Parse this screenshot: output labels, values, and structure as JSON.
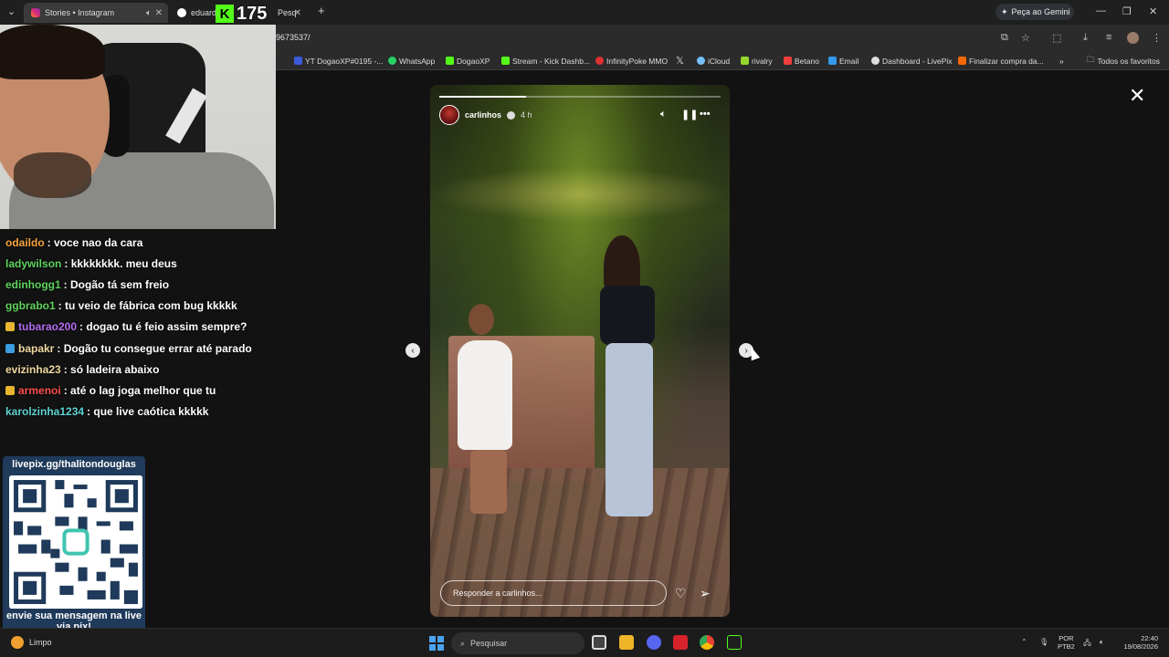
{
  "tabs": [
    {
      "title": "Stories • Instagram",
      "active": true
    },
    {
      "title": "eduarda",
      "active": false
    },
    {
      "title": "Pesq",
      "active": false
    }
  ],
  "new_tab_icon": "plus-icon",
  "gemini_label": "Peça ao Gemini",
  "url": "9673537/",
  "bookmarks": [
    {
      "label": "YT DogaoXP#0195 -...",
      "color": "#3b5bdb"
    },
    {
      "label": "WhatsApp",
      "color": "#25d366"
    },
    {
      "label": "DogaoXP",
      "color": "#53fc18"
    },
    {
      "label": "Stream - Kick Dashb...",
      "color": "#53fc18"
    },
    {
      "label": "InfinityPoke MMO",
      "color": "#e03131"
    },
    {
      "label": "",
      "color": "#ffffff"
    },
    {
      "label": "iCloud",
      "color": "#74c0fc"
    },
    {
      "label": "rivalry",
      "color": "#94d82d"
    },
    {
      "label": "Betano",
      "color": "#f03e3e"
    },
    {
      "label": "Email",
      "color": "#339af0"
    },
    {
      "label": "Dashboard - LivePix",
      "color": "#dddddd"
    },
    {
      "label": "Finalizar compra da...",
      "color": "#f76707"
    }
  ],
  "all_bookmarks": "Todos os favoritos",
  "kick_counter": "175",
  "story": {
    "username": "carlinhos",
    "time": "4 h",
    "progress": 0.31,
    "reply_placeholder": "Responder a carlinhos..."
  },
  "chat": [
    {
      "user": "odaildo",
      "color": "#f7a33a",
      "text": ": voce nao da cara",
      "badge": ""
    },
    {
      "user": "ladywilson",
      "color": "#5fd35f",
      "text": ": kkkkkkkk. meu deus",
      "badge": ""
    },
    {
      "user": "edinhogg1",
      "color": "#5fd35f",
      "text": ": Dogão tá sem freio",
      "badge": ""
    },
    {
      "user": "ggbrabo1",
      "color": "#5fd35f",
      "text": ": tu veio de fábrica com bug kkkkk",
      "badge": ""
    },
    {
      "user": "tubarao200",
      "color": "#b56cf0",
      "text": ": dogao tu é feio assim sempre?",
      "badge": "#e8b62f"
    },
    {
      "user": "bapakr",
      "color": "#f0d9a0",
      "text": ": Dogão tu consegue errar até parado",
      "badge": "#3a9ee0"
    },
    {
      "user": "evizinha23",
      "color": "#f0d9a0",
      "text": ": só ladeira abaixo",
      "badge": ""
    },
    {
      "user": "armenoi",
      "color": "#ff5050",
      "text": ": até o lag joga melhor que tu",
      "badge": "#e8b62f"
    },
    {
      "user": "karolzinha1234",
      "color": "#5fd3d3",
      "text": ": que live caótica kkkkk",
      "badge": ""
    }
  ],
  "livepix": {
    "title": "livepix.gg/thalitondouglas",
    "caption": "envie sua mensagem na live via pix!"
  },
  "taskbar": {
    "weather": "Limpo",
    "search": "Pesquisar",
    "lang_top": "POR",
    "lang_bottom": "PTB2",
    "time": "22:40",
    "date": "19/08/2026"
  }
}
